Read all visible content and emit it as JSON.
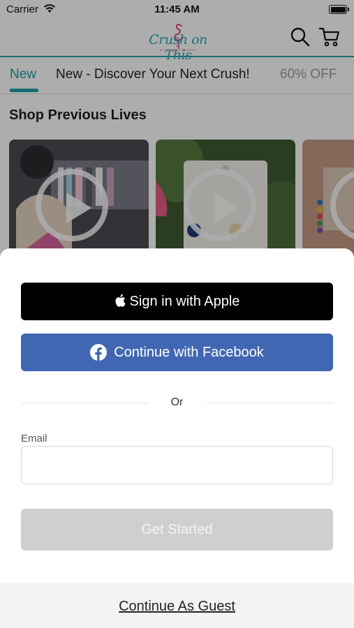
{
  "status_bar": {
    "carrier": "Carrier",
    "time": "11:45 AM"
  },
  "header": {
    "logo_text": "Crush on This",
    "logo_subtext": "BY HEATHER BROOKE",
    "icons": [
      "search-icon",
      "cart-icon"
    ]
  },
  "tabs": [
    {
      "label": "New",
      "active": true
    },
    {
      "label": "New  - Discover Your Next Crush!",
      "active": false
    },
    {
      "label": "60% OFF",
      "active": false
    }
  ],
  "section": {
    "title": "Shop Previous Lives"
  },
  "videos": [
    {
      "icon": "play-icon"
    },
    {
      "icon": "play-icon"
    },
    {
      "icon": "play-icon"
    }
  ],
  "login_sheet": {
    "apple_button": "Sign in with Apple",
    "facebook_button": "Continue with Facebook",
    "or_text": "Or",
    "email_label": "Email",
    "email_value": "",
    "email_placeholder": "",
    "get_started": "Get Started",
    "guest_link": "Continue As Guest"
  },
  "colors": {
    "accent_teal": "#1c9fa7",
    "facebook_blue": "#4267b2",
    "apple_black": "#000000",
    "disabled_gray": "#cfcfcf"
  }
}
